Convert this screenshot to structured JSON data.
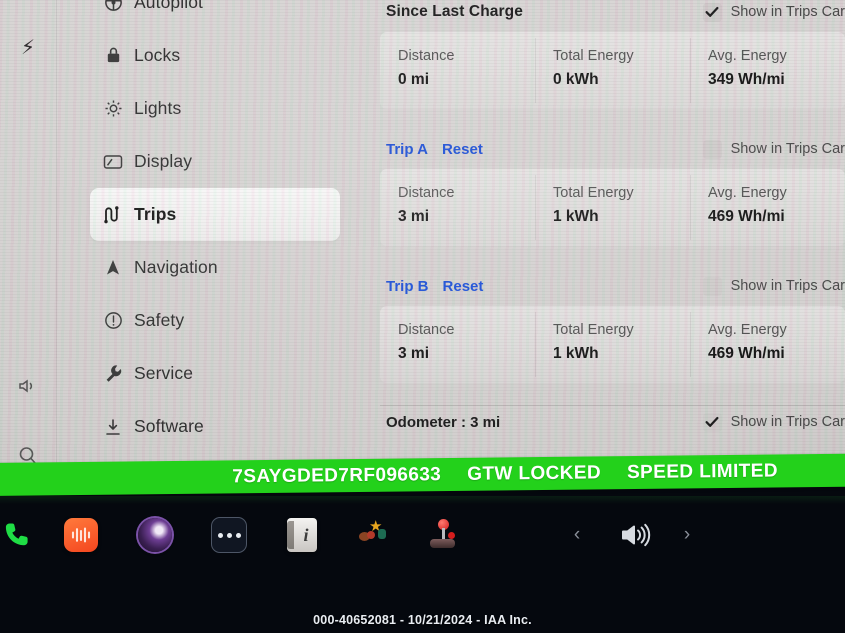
{
  "screen": {
    "rail": [
      {
        "name": "charging-bolt-icon",
        "glyph": "⚡"
      },
      {
        "name": "volume-icon",
        "glyph": "volume"
      },
      {
        "name": "search-icon",
        "glyph": "search"
      }
    ],
    "sidebar": {
      "items": [
        {
          "label": "Autopilot",
          "icon": "steering-wheel-icon",
          "active": false
        },
        {
          "label": "Locks",
          "icon": "lock-icon",
          "active": false
        },
        {
          "label": "Lights",
          "icon": "light-icon",
          "active": false
        },
        {
          "label": "Display",
          "icon": "display-icon",
          "active": false
        },
        {
          "label": "Trips",
          "icon": "trips-icon",
          "active": true
        },
        {
          "label": "Navigation",
          "icon": "navigation-icon",
          "active": false
        },
        {
          "label": "Safety",
          "icon": "safety-icon",
          "active": false
        },
        {
          "label": "Service",
          "icon": "wrench-icon",
          "active": false
        },
        {
          "label": "Software",
          "icon": "download-icon",
          "active": false
        }
      ]
    },
    "main": {
      "columns": [
        "Distance",
        "Total Energy",
        "Avg. Energy"
      ],
      "checkbox_label": "Show in Trips Car",
      "reset_label": "Reset",
      "sections": [
        {
          "title": "Since Last Charge",
          "kind": "title",
          "checked": true,
          "values": [
            "0 mi",
            "0 kWh",
            "349 Wh/mi"
          ]
        },
        {
          "title": "Trip A",
          "kind": "trip",
          "checked": false,
          "values": [
            "3 mi",
            "1 kWh",
            "469 Wh/mi"
          ]
        },
        {
          "title": "Trip B",
          "kind": "trip",
          "checked": false,
          "values": [
            "3 mi",
            "1 kWh",
            "469 Wh/mi"
          ]
        }
      ],
      "odometer": {
        "label": "Odometer :  3 mi",
        "checked": true,
        "checkbox_label": "Show in Trips Car"
      }
    }
  },
  "banner": {
    "vin": "7SAYGDED7RF096633",
    "status_1": "GTW LOCKED",
    "status_2": "SPEED LIMITED",
    "color": "#23d11b"
  },
  "dock": {
    "items": [
      {
        "name": "phone-icon",
        "label": "Phone"
      },
      {
        "name": "media-icon",
        "label": "Media"
      },
      {
        "name": "camera-icon",
        "label": "Camera"
      },
      {
        "name": "more-icon",
        "label": "More"
      },
      {
        "name": "info-notes-icon",
        "label": "Notes"
      },
      {
        "name": "toybox-icon",
        "label": "Toybox"
      },
      {
        "name": "joystick-icon",
        "label": "Arcade"
      }
    ],
    "volume": {
      "prev": "‹",
      "next": "›",
      "icon": "speaker-icon"
    }
  },
  "watermark": "000-40652081 - 10/21/2024 - IAA Inc."
}
